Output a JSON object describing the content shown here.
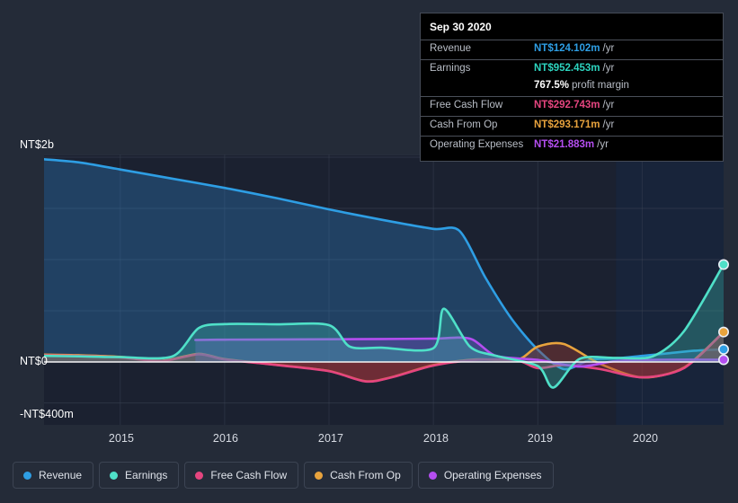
{
  "theme": {
    "background": "#242b38",
    "plot_background": "#1b2130",
    "forecast_band": "#18243a",
    "gridline": "#3c4454",
    "zero_line": "#ffffff",
    "tooltip_background": "#000000",
    "tooltip_border": "#454b57"
  },
  "tooltip": {
    "title": "Sep 30 2020",
    "unit_suffix": "/yr",
    "rows": [
      {
        "label": "Revenue",
        "value": "NT$124.102m",
        "color": "#2e9ee4"
      },
      {
        "label": "Earnings",
        "value": "NT$952.453m",
        "color": "#2dd4bf"
      },
      {
        "label": "Free Cash Flow",
        "value": "NT$292.743m",
        "color": "#e5457f"
      },
      {
        "label": "Cash From Op",
        "value": "NT$293.171m",
        "color": "#e8a33d"
      },
      {
        "label": "Operating Expenses",
        "value": "NT$21.883m",
        "color": "#b44ef0"
      }
    ],
    "profit_margin": {
      "value": "767.5%",
      "label": "profit margin"
    }
  },
  "legend": {
    "items": [
      {
        "label": "Revenue",
        "color": "#2e9ee4"
      },
      {
        "label": "Earnings",
        "color": "#4fe0c8"
      },
      {
        "label": "Free Cash Flow",
        "color": "#e5457f"
      },
      {
        "label": "Cash From Op",
        "color": "#e8a33d"
      },
      {
        "label": "Operating Expenses",
        "color": "#b44ef0"
      }
    ]
  },
  "chart_data": {
    "type": "area",
    "title": "",
    "xlabel": "",
    "ylabel": "",
    "grid": true,
    "legend_position": "bottom",
    "currency": "NT$",
    "ylim": [
      -400,
      2000
    ],
    "y_ticks": [
      {
        "value": 2000,
        "label": "NT$2b"
      },
      {
        "value": 0,
        "label": "NT$0"
      },
      {
        "value": -400,
        "label": "-NT$400m"
      }
    ],
    "y_gridlines": [
      2000,
      1500,
      1000,
      500,
      0,
      -400
    ],
    "x_ticks": [
      "2015",
      "2016",
      "2017",
      "2018",
      "2019",
      "2020"
    ],
    "x_tick_positions": [
      2015.0,
      2016.0,
      2017.0,
      2018.0,
      2019.0,
      2020.0
    ],
    "xlim": [
      2014.27,
      2020.78
    ],
    "forecast_start": 2019.75,
    "series": [
      {
        "name": "Revenue",
        "color": "#2e9ee4",
        "fill": "rgba(46,130,200,0.34)",
        "end_marker": true,
        "x": [
          2014.27,
          2014.6,
          2015.0,
          2015.5,
          2016.0,
          2016.5,
          2017.0,
          2017.5,
          2018.0,
          2018.25,
          2018.5,
          2018.75,
          2019.0,
          2019.25,
          2019.5,
          2019.75,
          2020.0,
          2020.25,
          2020.5,
          2020.78
        ],
        "values": [
          1980,
          1950,
          1880,
          1790,
          1700,
          1600,
          1490,
          1390,
          1300,
          1280,
          820,
          420,
          120,
          -70,
          20,
          35,
          60,
          85,
          110,
          124
        ]
      },
      {
        "name": "Earnings",
        "color": "#4fe0c8",
        "fill": "rgba(60,180,170,0.35)",
        "end_marker": true,
        "x": [
          2014.27,
          2014.6,
          2015.0,
          2015.5,
          2015.75,
          2016.0,
          2016.5,
          2017.0,
          2017.2,
          2017.5,
          2018.0,
          2018.1,
          2018.35,
          2018.6,
          2019.0,
          2019.15,
          2019.4,
          2019.75,
          2020.1,
          2020.4,
          2020.78
        ],
        "values": [
          60,
          55,
          48,
          55,
          330,
          370,
          368,
          360,
          150,
          140,
          135,
          520,
          150,
          60,
          -40,
          -250,
          30,
          40,
          55,
          300,
          952
        ]
      },
      {
        "name": "Free Cash Flow",
        "color": "#e5457f",
        "fill": "rgba(160,45,60,0.40)",
        "end_marker": false,
        "x": [
          2014.27,
          2014.6,
          2015.0,
          2015.4,
          2015.75,
          2016.0,
          2016.5,
          2017.0,
          2017.35,
          2017.6,
          2018.0,
          2018.4,
          2018.8,
          2019.0,
          2019.25,
          2019.6,
          2020.0,
          2020.4,
          2020.78
        ],
        "values": [
          65,
          60,
          45,
          10,
          75,
          25,
          -30,
          -90,
          -190,
          -150,
          -35,
          20,
          15,
          -60,
          -30,
          -70,
          -150,
          -60,
          292
        ]
      },
      {
        "name": "Cash From Op",
        "color": "#e8a33d",
        "fill": "rgba(150,60,55,0.42)",
        "end_marker": true,
        "x": [
          2014.27,
          2014.6,
          2015.0,
          2015.4,
          2015.75,
          2016.0,
          2016.5,
          2017.0,
          2017.35,
          2017.6,
          2018.0,
          2018.4,
          2018.8,
          2019.0,
          2019.25,
          2019.6,
          2020.0,
          2020.4,
          2020.78
        ],
        "values": [
          72,
          66,
          50,
          12,
          80,
          28,
          -28,
          -88,
          -188,
          -148,
          -30,
          25,
          20,
          150,
          175,
          -20,
          -150,
          -55,
          293
        ]
      },
      {
        "name": "Operating Expenses",
        "color": "#b44ef0",
        "fill": "rgba(110,80,190,0.42)",
        "end_marker": true,
        "x": [
          2015.72,
          2016.0,
          2016.5,
          2017.0,
          2017.5,
          2018.0,
          2018.35,
          2018.6,
          2019.0,
          2019.4,
          2019.75,
          2020.2,
          2020.78
        ],
        "values": [
          215,
          218,
          220,
          222,
          224,
          228,
          228,
          60,
          20,
          -45,
          10,
          22,
          22
        ]
      }
    ]
  }
}
